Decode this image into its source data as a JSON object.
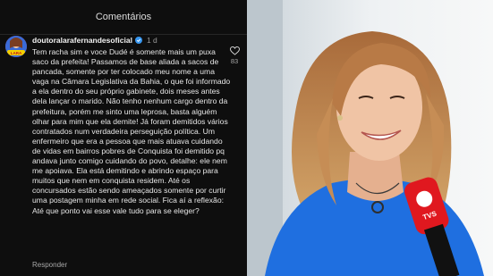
{
  "panel": {
    "title": "Comentários"
  },
  "comment": {
    "username": "doutoralarafernandesoficial",
    "time": "1 d",
    "text": "Tem racha sim e voce Dudé é somente mais um puxa saco da prefeita! Passamos de base aliada a sacos de pancada, somente por ter colocado meu nome a uma vaga na Câmara Legislativa da Bahia, o que foi informado a ela dentro do seu próprio gabinete, dois meses antes dela lançar o marido. Não tenho nenhum cargo dentro da prefeitura, porém me sinto uma leprosa, basta alguém olhar para mim que ela demite! Já foram demitidos vários contratados num verdadeira perseguição política. Um enfermeiro que era a pessoa que mais atuava cuidando de vidas em bairros pobres de Conquista foi demitido pq andava junto comigo cuidando do povo, detalhe: ele nem me apoiava. Ela está demitindo e abrindo espaço para muitos que nem em conquista residem. Até os concursados estão sendo ameaçados somente por curtir uma postagem minha em rede social.  Fica aí a reflexão: Até que ponto vai esse vale tudo para se eleger?",
    "like_count": "83",
    "reply_label": "Responder"
  },
  "avatar_badge": "LARA",
  "microphone_brand": "TVS",
  "icons": {
    "verified": "verified-badge-icon",
    "like": "heart-icon"
  },
  "colors": {
    "panel_bg": "#0e0e0e",
    "verified": "#3897f0",
    "shirt": "#1f6fe0",
    "mic": "#e0181f"
  }
}
